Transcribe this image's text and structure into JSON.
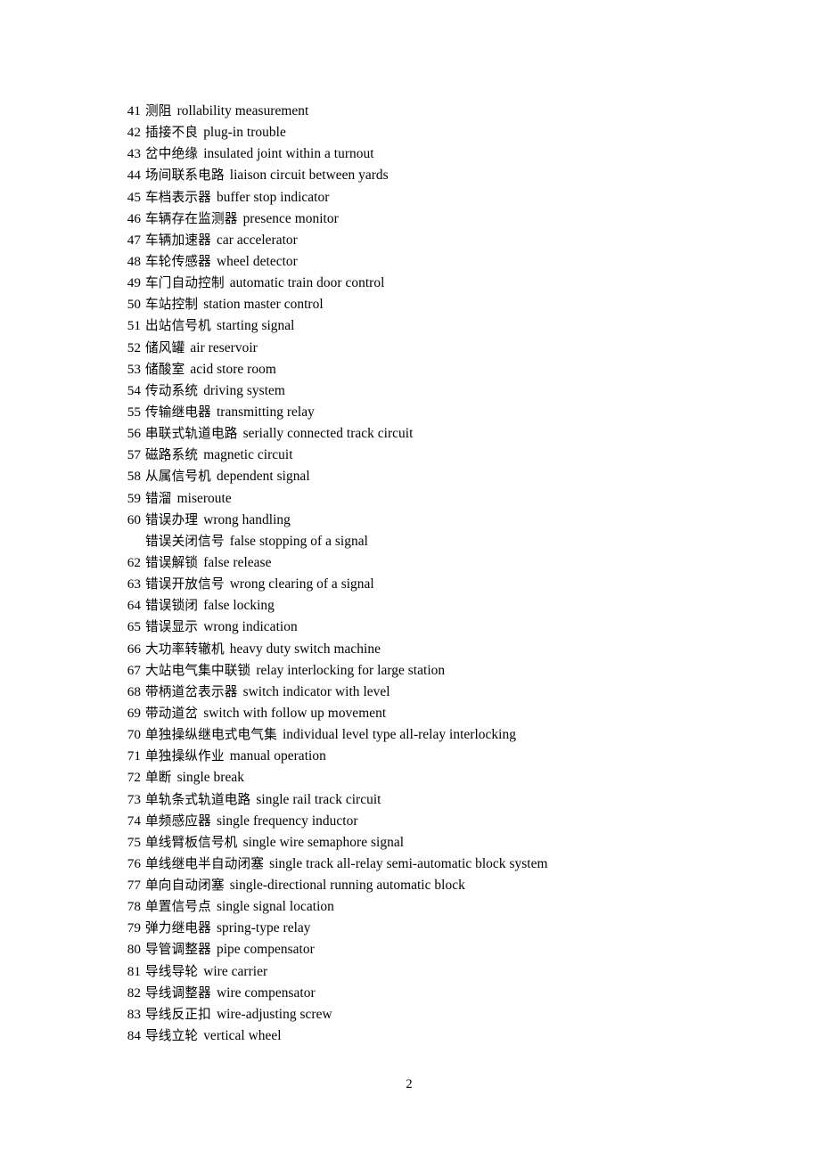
{
  "document": {
    "page_number": "2",
    "entries": [
      {
        "num": "41",
        "zh": "测阻",
        "en": "rollability measurement"
      },
      {
        "num": "42",
        "zh": "插接不良",
        "en": "plug-in trouble"
      },
      {
        "num": "43",
        "zh": "岔中绝缘",
        "en": "insulated joint within a turnout"
      },
      {
        "num": "44",
        "zh": "场间联系电路",
        "en": "liaison circuit between yards"
      },
      {
        "num": "45",
        "zh": "车档表示器",
        "en": "buffer stop indicator"
      },
      {
        "num": "46",
        "zh": "车辆存在监测器",
        "en": "presence monitor"
      },
      {
        "num": "47",
        "zh": "车辆加速器",
        "en": "car accelerator"
      },
      {
        "num": "48",
        "zh": "车轮传感器",
        "en": "wheel detector"
      },
      {
        "num": "49",
        "zh": "车门自动控制",
        "en": "automatic train door control"
      },
      {
        "num": "50",
        "zh": "车站控制",
        "en": "station master control"
      },
      {
        "num": "51",
        "zh": "出站信号机",
        "en": "starting signal"
      },
      {
        "num": "52",
        "zh": "储风罐",
        "en": "air reservoir"
      },
      {
        "num": "53",
        "zh": "储酸室",
        "en": "acid store room"
      },
      {
        "num": "54",
        "zh": "传动系统",
        "en": "driving system"
      },
      {
        "num": "55",
        "zh": "传输继电器",
        "en": "transmitting relay"
      },
      {
        "num": "56",
        "zh": "串联式轨道电路",
        "en": "serially connected track circuit"
      },
      {
        "num": "57",
        "zh": "磁路系统",
        "en": "magnetic circuit"
      },
      {
        "num": "58",
        "zh": "从属信号机",
        "en": "dependent signal"
      },
      {
        "num": "59",
        "zh": "错溜",
        "en": "miseroute"
      },
      {
        "num": "60",
        "zh": "错误办理",
        "en": "wrong handling"
      },
      {
        "num": "",
        "zh": "错误关闭信号",
        "en": "false stopping of a signal"
      },
      {
        "num": "62",
        "zh": "错误解锁",
        "en": "false release"
      },
      {
        "num": "63",
        "zh": "错误开放信号",
        "en": "wrong clearing of a signal"
      },
      {
        "num": "64",
        "zh": "错误锁闭",
        "en": "false locking"
      },
      {
        "num": "65",
        "zh": "错误显示",
        "en": "wrong indication"
      },
      {
        "num": "66",
        "zh": "大功率转辙机",
        "en": "heavy duty switch machine"
      },
      {
        "num": "67",
        "zh": "大站电气集中联锁",
        "en": "relay interlocking for large station"
      },
      {
        "num": "68",
        "zh": "带柄道岔表示器",
        "en": "switch indicator with level"
      },
      {
        "num": "69",
        "zh": "带动道岔",
        "en": "switch with follow up movement"
      },
      {
        "num": "70",
        "zh": "单独操纵继电式电气集",
        "en": "individual level type all-relay interlocking"
      },
      {
        "num": "71",
        "zh": "单独操纵作业",
        "en": "manual operation"
      },
      {
        "num": "72",
        "zh": "单断",
        "en": "single break"
      },
      {
        "num": "73",
        "zh": "单轨条式轨道电路",
        "en": "single rail track circuit"
      },
      {
        "num": "74",
        "zh": "单频感应器",
        "en": "single frequency inductor"
      },
      {
        "num": "75",
        "zh": "单线臂板信号机",
        "en": "single wire semaphore signal"
      },
      {
        "num": "76",
        "zh": "单线继电半自动闭塞",
        "en": "single track all-relay semi-automatic block system"
      },
      {
        "num": "77",
        "zh": "单向自动闭塞",
        "en": "single-directional running automatic block"
      },
      {
        "num": "78",
        "zh": "单置信号点",
        "en": "single signal location"
      },
      {
        "num": "79",
        "zh": "弹力继电器",
        "en": "spring-type relay"
      },
      {
        "num": "80",
        "zh": "导管调整器",
        "en": "pipe compensator"
      },
      {
        "num": "81",
        "zh": "导线导轮",
        "en": "wire carrier"
      },
      {
        "num": "82",
        "zh": "导线调整器",
        "en": "wire compensator"
      },
      {
        "num": "83",
        "zh": "导线反正扣",
        "en": "wire-adjusting screw"
      },
      {
        "num": "84",
        "zh": "导线立轮",
        "en": "vertical wheel"
      }
    ]
  }
}
